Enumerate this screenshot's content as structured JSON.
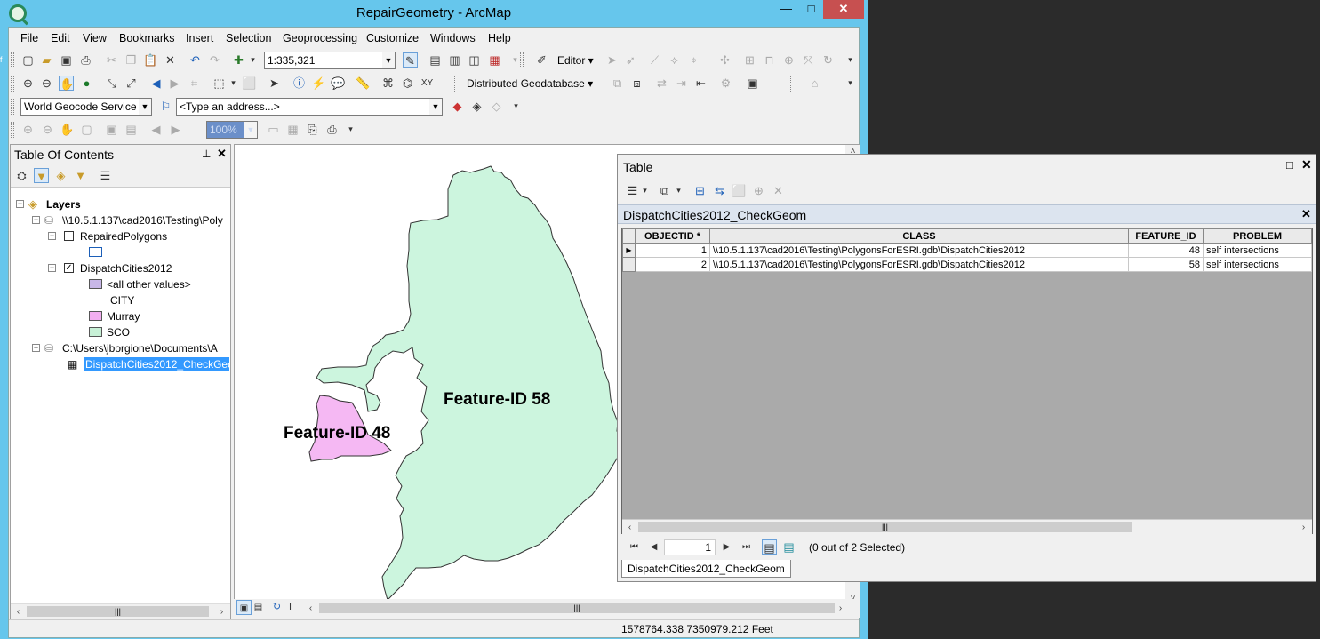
{
  "window": {
    "title": "RepairGeometry - ArcMap",
    "buttons": {
      "minimize": "—",
      "maximize": "□",
      "close": "✕"
    }
  },
  "menu": [
    "File",
    "Edit",
    "View",
    "Bookmarks",
    "Insert",
    "Selection",
    "Geoprocessing",
    "Customize",
    "Windows",
    "Help"
  ],
  "toolbars": {
    "scale": "1:335,321",
    "editor_label": "Editor ▾",
    "distributed_gdb_label": "Distributed Geodatabase ▾",
    "geocode_service": "World Geocode Service (A",
    "address_placeholder": "<Type an address...>",
    "zoom_percent": "100%"
  },
  "toc": {
    "title": "Table Of Contents",
    "pin": "ᵖ",
    "close": "✕",
    "items": [
      {
        "label": "Layers",
        "bold": true
      },
      {
        "label": "\\\\10.5.1.137\\cad2016\\Testing\\Poly"
      },
      {
        "label": "RepairedPolygons",
        "checked": false
      },
      {
        "label": "DispatchCities2012",
        "checked": true
      },
      {
        "label": "<all other values>",
        "color": "#c8b7e8"
      },
      {
        "label": "CITY"
      },
      {
        "label": "Murray",
        "color": "#f2aef0"
      },
      {
        "label": "SCO",
        "color": "#c7f0d6"
      },
      {
        "label": "C:\\Users\\jborgione\\Documents\\A"
      },
      {
        "label": "DispatchCities2012_CheckGeo",
        "selected": true
      }
    ]
  },
  "map": {
    "label_large": "Feature-ID 58",
    "label_small": "Feature-ID 48",
    "colors": {
      "large_polygon": "#ccf5de",
      "small_polygon": "#f5b8f3",
      "outline": "#333333"
    }
  },
  "status": {
    "coordinates": "1578764.338  7350979.212 Feet"
  },
  "table": {
    "window_title": "Table",
    "max_btn": "□",
    "close_btn": "✕",
    "table_name": "DispatchCities2012_CheckGeom",
    "columns": [
      "OBJECTID *",
      "CLASS",
      "FEATURE_ID",
      "PROBLEM"
    ],
    "rows": [
      [
        "1",
        "\\\\10.5.1.137\\cad2016\\Testing\\PolygonsForESRI.gdb\\DispatchCities2012",
        "48",
        "self intersections"
      ],
      [
        "2",
        "\\\\10.5.1.137\\cad2016\\Testing\\PolygonsForESRI.gdb\\DispatchCities2012",
        "58",
        "self intersections"
      ]
    ],
    "current_record": "1",
    "selection_status": "(0 out of 2 Selected)",
    "tab_label": "DispatchCities2012_CheckGeom"
  }
}
